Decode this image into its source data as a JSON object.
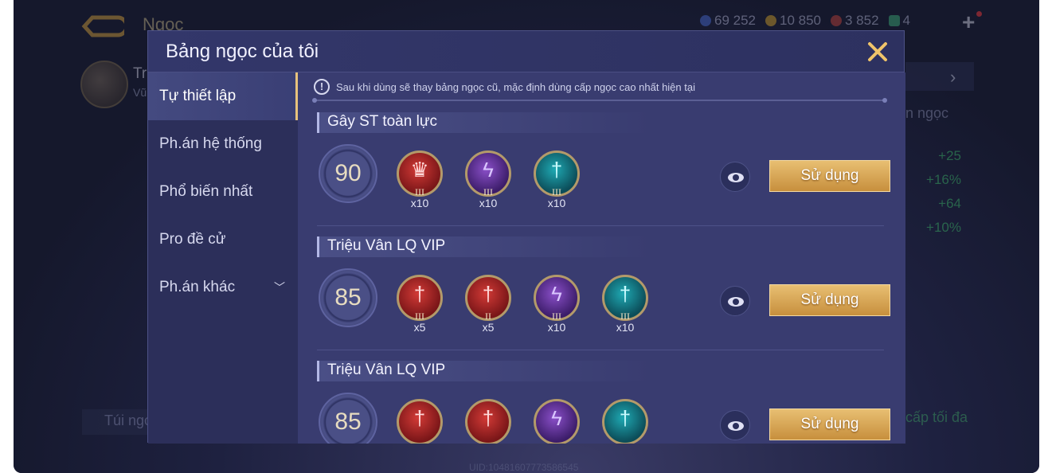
{
  "background": {
    "title": "Ngọc",
    "currency": [
      {
        "icon": "gem-blue-icon",
        "value": "69 252",
        "color": "#4a6fd6"
      },
      {
        "icon": "coin-gold-icon",
        "value": "10 850",
        "color": "#d6a52a"
      },
      {
        "icon": "gem-red-icon",
        "value": "3 852",
        "color": "#c8453a"
      },
      {
        "icon": "ticket-icon",
        "value": "4",
        "color": "#3fb07a"
      }
    ],
    "player_name_partial": "Tr",
    "player_sub_partial": "Vũ",
    "ngoc_label_partial": "n ngọc",
    "stats": [
      "+25",
      "+16%",
      "+64",
      "+10%"
    ],
    "bottom_left_label": "Túi ngọ",
    "bottom_right_label": "cấp tối đa",
    "uid": "UID:10481607773586545"
  },
  "modal": {
    "title": "Bảng ngọc của tôi",
    "sidebar": [
      {
        "label": "Tự thiết lập",
        "active": true
      },
      {
        "label": "Ph.án hệ thống",
        "active": false
      },
      {
        "label": "Phổ biến nhất",
        "active": false
      },
      {
        "label": "Pro đề cử",
        "active": false
      },
      {
        "label": "Ph.án khác",
        "active": false
      }
    ],
    "notice": "Sau khi dùng sẽ thay bảng ngọc cũ, mặc định dùng cấp ngọc cao nhất hiện tại",
    "use_label": "Sử dụng",
    "sets": [
      {
        "name": "Gây ST toàn lực",
        "level": "90",
        "gems": [
          {
            "color": "red",
            "icon": "claw-gem-icon",
            "tier": "III",
            "count": "x10"
          },
          {
            "color": "purple",
            "icon": "lightning-gem-icon",
            "tier": "III",
            "count": "x10"
          },
          {
            "color": "cyan",
            "icon": "sword-gem-icon",
            "tier": "III",
            "count": "x10"
          }
        ]
      },
      {
        "name": "Triệu Vân LQ VIP",
        "level": "85",
        "gems": [
          {
            "color": "red",
            "icon": "sword-gem-icon",
            "tier": "III",
            "count": "x5"
          },
          {
            "color": "red",
            "icon": "sword-gem-icon",
            "tier": "II",
            "count": "x5"
          },
          {
            "color": "purple",
            "icon": "lightning-gem-icon",
            "tier": "III",
            "count": "x10"
          },
          {
            "color": "cyan",
            "icon": "sword-gem-icon",
            "tier": "III",
            "count": "x10"
          }
        ]
      },
      {
        "name": "Triệu Vân LQ VIP",
        "level": "85",
        "gems": [
          {
            "color": "red",
            "icon": "sword-gem-icon",
            "tier": "",
            "count": ""
          },
          {
            "color": "red",
            "icon": "sword-gem-icon",
            "tier": "",
            "count": ""
          },
          {
            "color": "purple",
            "icon": "lightning-gem-icon",
            "tier": "",
            "count": ""
          },
          {
            "color": "cyan",
            "icon": "sword-gem-icon",
            "tier": "",
            "count": ""
          }
        ]
      }
    ]
  }
}
